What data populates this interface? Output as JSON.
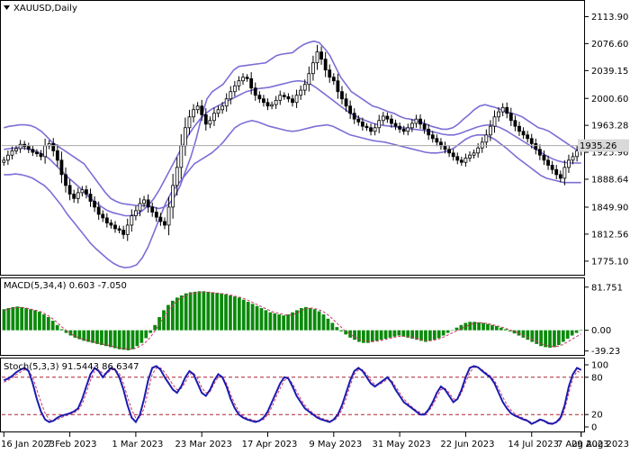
{
  "colors": {
    "background": "#ffffff",
    "candle": "#000000",
    "bollinger": "#7b6fd6",
    "macd_hist": "#0a8a0a",
    "macd_signal": "#cc3366",
    "stoch_main": "#1b1bb0",
    "stoch_signal": "#cc3366",
    "level_line": "#aa2233",
    "current_price_tag": "#d9d9d9"
  },
  "chart_data": [
    {
      "type": "candlestick",
      "title": "XAUUSD,Daily",
      "ylim": [
        1760,
        2132
      ],
      "y_ticks": [
        "2113.90",
        "2076.60",
        "2039.15",
        "2000.60",
        "1963.28",
        "1925.96",
        "1888.64",
        "1849.90",
        "1812.56",
        "1775.10"
      ],
      "y_tick_values": [
        2113.9,
        2076.6,
        2039.15,
        2000.6,
        1963.28,
        1925.96,
        1888.64,
        1849.9,
        1812.56,
        1775.1
      ],
      "current_price": "1935.26",
      "current_price_value": 1935.26,
      "close": [
        1915,
        1922,
        1928,
        1931,
        1937,
        1934,
        1930,
        1926,
        1924,
        1920,
        1935,
        1938,
        1928,
        1915,
        1895,
        1880,
        1868,
        1862,
        1870,
        1874,
        1868,
        1858,
        1850,
        1840,
        1835,
        1828,
        1825,
        1820,
        1818,
        1812,
        1825,
        1838,
        1845,
        1855,
        1860,
        1850,
        1843,
        1836,
        1830,
        1825,
        1850,
        1880,
        1905,
        1935,
        1960,
        1975,
        1985,
        1990,
        1978,
        1965,
        1970,
        1980,
        1985,
        1990,
        2000,
        2010,
        2018,
        2025,
        2030,
        2028,
        2015,
        2005,
        2000,
        1995,
        1990,
        1992,
        1998,
        2005,
        2003,
        2000,
        1995,
        2005,
        2012,
        2020,
        2035,
        2050,
        2065,
        2055,
        2040,
        2030,
        2025,
        2010,
        2000,
        1990,
        1980,
        1972,
        1968,
        1962,
        1960,
        1955,
        1960,
        1970,
        1976,
        1972,
        1966,
        1962,
        1958,
        1955,
        1960,
        1966,
        1972,
        1965,
        1958,
        1950,
        1945,
        1940,
        1935,
        1930,
        1925,
        1920,
        1915,
        1912,
        1918,
        1922,
        1925,
        1932,
        1940,
        1950,
        1962,
        1975,
        1982,
        1988,
        1980,
        1970,
        1962,
        1955,
        1950,
        1945,
        1938,
        1930,
        1922,
        1915,
        1908,
        1902,
        1895,
        1890,
        1905,
        1915,
        1920,
        1928,
        1935.26
      ],
      "bollinger_upper": [
        1960,
        1962,
        1963,
        1964,
        1964,
        1963,
        1960,
        1955,
        1948,
        1940,
        1935,
        1930,
        1925,
        1920,
        1915,
        1910,
        1900,
        1890,
        1880,
        1870,
        1862,
        1858,
        1855,
        1854,
        1853,
        1852,
        1852,
        1852,
        1850,
        1848,
        1850,
        1855,
        1865,
        1880,
        1900,
        1920,
        1945,
        1975,
        2000,
        2010,
        2015,
        2020,
        2030,
        2040,
        2045,
        2046,
        2047,
        2048,
        2049,
        2050,
        2055,
        2060,
        2062,
        2063,
        2064,
        2070,
        2075,
        2078,
        2080,
        2078,
        2070,
        2060,
        2045,
        2030,
        2020,
        2010,
        2005,
        2000,
        1995,
        1990,
        1988,
        1985,
        1982,
        1980,
        1976,
        1973,
        1972,
        1970,
        1968,
        1965,
        1962,
        1960,
        1958,
        1958,
        1960,
        1965,
        1972,
        1978,
        1985,
        1990,
        1992,
        1990,
        1988,
        1985,
        1982,
        1980,
        1978,
        1975,
        1970,
        1965,
        1960,
        1958,
        1955,
        1950,
        1945,
        1940,
        1935,
        1930,
        1928
      ],
      "bollinger_middle": [
        1930,
        1931,
        1932,
        1932,
        1931,
        1929,
        1926,
        1922,
        1916,
        1908,
        1900,
        1892,
        1885,
        1878,
        1870,
        1862,
        1856,
        1850,
        1845,
        1842,
        1840,
        1838,
        1838,
        1840,
        1845,
        1852,
        1862,
        1875,
        1890,
        1905,
        1920,
        1935,
        1950,
        1962,
        1972,
        1980,
        1986,
        1990,
        1994,
        1998,
        2002,
        2006,
        2010,
        2012,
        2014,
        2015,
        2016,
        2018,
        2020,
        2022,
        2024,
        2025,
        2024,
        2021,
        2016,
        2010,
        2004,
        1998,
        1992,
        1986,
        1980,
        1976,
        1972,
        1969,
        1966,
        1964,
        1963,
        1962,
        1961,
        1960,
        1959,
        1958,
        1957,
        1956,
        1955,
        1953,
        1951,
        1950,
        1950,
        1952,
        1955,
        1958,
        1961,
        1963,
        1964,
        1963,
        1960,
        1956,
        1951,
        1946,
        1941,
        1936,
        1931,
        1926,
        1921,
        1917,
        1914,
        1912,
        1911,
        1911,
        1911
      ],
      "bollinger_lower": [
        1895,
        1895,
        1896,
        1895,
        1893,
        1890,
        1885,
        1880,
        1872,
        1862,
        1852,
        1840,
        1830,
        1820,
        1810,
        1800,
        1792,
        1785,
        1778,
        1772,
        1768,
        1766,
        1767,
        1770,
        1780,
        1795,
        1815,
        1835,
        1855,
        1870,
        1880,
        1890,
        1900,
        1910,
        1915,
        1920,
        1925,
        1932,
        1940,
        1950,
        1960,
        1965,
        1968,
        1970,
        1968,
        1965,
        1962,
        1960,
        1958,
        1956,
        1955,
        1956,
        1958,
        1960,
        1962,
        1963,
        1964,
        1962,
        1958,
        1954,
        1950,
        1948,
        1946,
        1944,
        1942,
        1941,
        1940,
        1938,
        1936,
        1934,
        1932,
        1930,
        1928,
        1926,
        1925,
        1925,
        1926,
        1928,
        1932,
        1938,
        1944,
        1948,
        1950,
        1950,
        1948,
        1944,
        1938,
        1932,
        1925,
        1918,
        1912,
        1906,
        1900,
        1894,
        1890,
        1888,
        1886,
        1884,
        1884,
        1884,
        1884
      ],
      "x_ticks": [
        "16 Jan 2023",
        "7 Feb 2023",
        "1 Mar 2023",
        "23 Mar 2023",
        "17 Apr 2023",
        "9 May 2023",
        "31 May 2023",
        "22 Jun 2023",
        "14 Jul 2023",
        "7 Aug 2023",
        "29 Aug 2023"
      ],
      "x_tick_index": [
        0,
        16,
        32,
        48,
        64,
        80,
        96,
        112,
        128,
        144,
        160
      ]
    },
    {
      "type": "bar",
      "title": "MACD(5,34,4) 0.603 -7.050",
      "ylim": [
        -45,
        95
      ],
      "y_ticks": [
        "81.751",
        "0.00",
        "-39.23"
      ],
      "y_tick_values": [
        81.751,
        0,
        -39.23
      ],
      "values": [
        40,
        42,
        44,
        45,
        44,
        42,
        40,
        38,
        35,
        30,
        25,
        18,
        10,
        2,
        -5,
        -10,
        -14,
        -17,
        -20,
        -22,
        -24,
        -26,
        -28,
        -30,
        -32,
        -34,
        -36,
        -37,
        -38,
        -36,
        -30,
        -24,
        -15,
        -5,
        10,
        25,
        38,
        48,
        56,
        62,
        66,
        70,
        72,
        73,
        74,
        74,
        73,
        72,
        71,
        70,
        68,
        66,
        64,
        62,
        58,
        54,
        50,
        46,
        42,
        38,
        34,
        32,
        30,
        28,
        30,
        34,
        38,
        42,
        44,
        42,
        40,
        36,
        30,
        22,
        14,
        6,
        -2,
        -8,
        -14,
        -18,
        -22,
        -24,
        -24,
        -22,
        -20,
        -18,
        -16,
        -14,
        -12,
        -10,
        -12,
        -14,
        -16,
        -18,
        -20,
        -22,
        -20,
        -18,
        -15,
        -10,
        -5,
        0,
        5,
        10,
        14,
        16,
        16,
        15,
        14,
        12,
        10,
        8,
        5,
        2,
        -2,
        -6,
        -10,
        -14,
        -18,
        -22,
        -26,
        -30,
        -32,
        -33,
        -32,
        -28,
        -22,
        -16,
        -10,
        -5,
        0.603
      ],
      "signal": [
        38,
        40,
        42,
        43,
        43,
        42,
        40,
        38,
        36,
        32,
        27,
        21,
        14,
        6,
        -1,
        -7,
        -12,
        -15,
        -18,
        -20,
        -22,
        -24,
        -26,
        -28,
        -30,
        -32,
        -34,
        -35,
        -36,
        -35,
        -32,
        -27,
        -20,
        -10,
        2,
        15,
        28,
        40,
        50,
        58,
        63,
        67,
        70,
        71,
        72,
        73,
        72,
        71,
        70,
        69,
        68,
        66,
        64,
        62,
        59,
        55,
        51,
        47,
        43,
        39,
        35,
        33,
        31,
        29,
        29,
        31,
        35,
        39,
        42,
        42,
        40,
        37,
        32,
        25,
        17,
        9,
        1,
        -5,
        -11,
        -15,
        -19,
        -21,
        -22,
        -21,
        -20,
        -18,
        -16,
        -14,
        -12,
        -11,
        -12,
        -13,
        -15,
        -17,
        -19,
        -20,
        -19,
        -17,
        -14,
        -10,
        -6,
        -2,
        2,
        6,
        10,
        13,
        14,
        14,
        13,
        11,
        9,
        7,
        4,
        1,
        -2,
        -5,
        -9,
        -13,
        -17,
        -21,
        -25,
        -28,
        -30,
        -31,
        -30,
        -27,
        -22,
        -17,
        -12,
        -7.05
      ]
    },
    {
      "type": "line",
      "title": "Stoch(5,3,3) 91.5443 86.6347",
      "ylim": [
        0,
        100
      ],
      "y_ticks": [
        "100",
        "80",
        "20",
        "0"
      ],
      "y_tick_values": [
        100,
        80,
        20,
        0
      ],
      "levels": [
        80,
        20
      ],
      "main": [
        75,
        78,
        82,
        88,
        92,
        95,
        90,
        70,
        45,
        25,
        12,
        8,
        10,
        15,
        18,
        20,
        22,
        25,
        30,
        45,
        65,
        85,
        95,
        90,
        80,
        88,
        95,
        92,
        80,
        60,
        35,
        15,
        8,
        20,
        45,
        75,
        95,
        98,
        92,
        80,
        70,
        60,
        55,
        65,
        80,
        90,
        85,
        70,
        55,
        50,
        60,
        75,
        85,
        80,
        65,
        45,
        30,
        20,
        15,
        12,
        10,
        8,
        10,
        15,
        25,
        40,
        55,
        70,
        80,
        78,
        65,
        50,
        40,
        30,
        25,
        20,
        15,
        12,
        10,
        8,
        12,
        20,
        35,
        55,
        75,
        90,
        95,
        90,
        80,
        70,
        65,
        70,
        75,
        80,
        72,
        60,
        50,
        40,
        35,
        30,
        25,
        20,
        20,
        28,
        40,
        55,
        65,
        60,
        50,
        40,
        45,
        60,
        80,
        95,
        98,
        96,
        90,
        85,
        80,
        70,
        55,
        40,
        30,
        22,
        18,
        15,
        12,
        10,
        5,
        8,
        12,
        10,
        6,
        5,
        8,
        15,
        35,
        65,
        85,
        95,
        91.5443
      ],
      "signal": [
        72,
        75,
        79,
        84,
        88,
        92,
        90,
        80,
        60,
        40,
        22,
        12,
        10,
        12,
        15,
        18,
        20,
        23,
        27,
        37,
        55,
        75,
        90,
        92,
        86,
        86,
        92,
        92,
        86,
        70,
        48,
        28,
        14,
        15,
        30,
        58,
        85,
        95,
        95,
        88,
        78,
        68,
        60,
        62,
        72,
        85,
        87,
        78,
        63,
        55,
        57,
        70,
        80,
        80,
        70,
        52,
        37,
        25,
        18,
        14,
        12,
        10,
        10,
        12,
        20,
        32,
        48,
        62,
        75,
        78,
        70,
        57,
        45,
        35,
        28,
        22,
        18,
        14,
        12,
        10,
        10,
        16,
        28,
        46,
        67,
        85,
        92,
        92,
        85,
        75,
        68,
        68,
        72,
        77,
        75,
        65,
        55,
        45,
        38,
        32,
        27,
        23,
        21,
        25,
        35,
        48,
        60,
        62,
        55,
        45,
        44,
        55,
        72,
        88,
        96,
        96,
        92,
        87,
        82,
        74,
        62,
        48,
        36,
        27,
        21,
        17,
        14,
        11,
        7,
        8,
        10,
        10,
        8,
        6,
        7,
        12,
        28,
        55,
        78,
        90,
        86.6347
      ]
    }
  ]
}
